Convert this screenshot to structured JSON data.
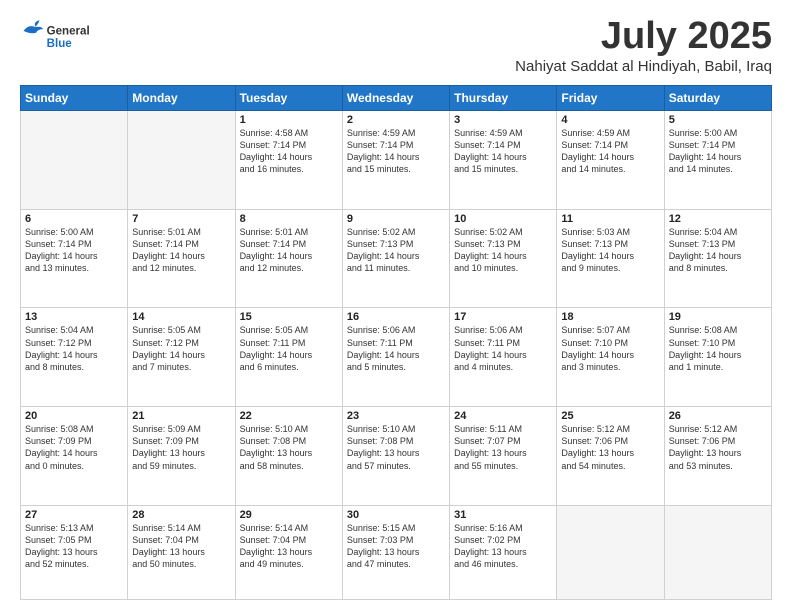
{
  "header": {
    "logo_general": "General",
    "logo_blue": "Blue",
    "month": "July 2025",
    "location": "Nahiyat Saddat al Hindiyah, Babil, Iraq"
  },
  "weekdays": [
    "Sunday",
    "Monday",
    "Tuesday",
    "Wednesday",
    "Thursday",
    "Friday",
    "Saturday"
  ],
  "weeks": [
    [
      {
        "day": "",
        "info": ""
      },
      {
        "day": "",
        "info": ""
      },
      {
        "day": "1",
        "info": "Sunrise: 4:58 AM\nSunset: 7:14 PM\nDaylight: 14 hours\nand 16 minutes."
      },
      {
        "day": "2",
        "info": "Sunrise: 4:59 AM\nSunset: 7:14 PM\nDaylight: 14 hours\nand 15 minutes."
      },
      {
        "day": "3",
        "info": "Sunrise: 4:59 AM\nSunset: 7:14 PM\nDaylight: 14 hours\nand 15 minutes."
      },
      {
        "day": "4",
        "info": "Sunrise: 4:59 AM\nSunset: 7:14 PM\nDaylight: 14 hours\nand 14 minutes."
      },
      {
        "day": "5",
        "info": "Sunrise: 5:00 AM\nSunset: 7:14 PM\nDaylight: 14 hours\nand 14 minutes."
      }
    ],
    [
      {
        "day": "6",
        "info": "Sunrise: 5:00 AM\nSunset: 7:14 PM\nDaylight: 14 hours\nand 13 minutes."
      },
      {
        "day": "7",
        "info": "Sunrise: 5:01 AM\nSunset: 7:14 PM\nDaylight: 14 hours\nand 12 minutes."
      },
      {
        "day": "8",
        "info": "Sunrise: 5:01 AM\nSunset: 7:14 PM\nDaylight: 14 hours\nand 12 minutes."
      },
      {
        "day": "9",
        "info": "Sunrise: 5:02 AM\nSunset: 7:13 PM\nDaylight: 14 hours\nand 11 minutes."
      },
      {
        "day": "10",
        "info": "Sunrise: 5:02 AM\nSunset: 7:13 PM\nDaylight: 14 hours\nand 10 minutes."
      },
      {
        "day": "11",
        "info": "Sunrise: 5:03 AM\nSunset: 7:13 PM\nDaylight: 14 hours\nand 9 minutes."
      },
      {
        "day": "12",
        "info": "Sunrise: 5:04 AM\nSunset: 7:13 PM\nDaylight: 14 hours\nand 8 minutes."
      }
    ],
    [
      {
        "day": "13",
        "info": "Sunrise: 5:04 AM\nSunset: 7:12 PM\nDaylight: 14 hours\nand 8 minutes."
      },
      {
        "day": "14",
        "info": "Sunrise: 5:05 AM\nSunset: 7:12 PM\nDaylight: 14 hours\nand 7 minutes."
      },
      {
        "day": "15",
        "info": "Sunrise: 5:05 AM\nSunset: 7:11 PM\nDaylight: 14 hours\nand 6 minutes."
      },
      {
        "day": "16",
        "info": "Sunrise: 5:06 AM\nSunset: 7:11 PM\nDaylight: 14 hours\nand 5 minutes."
      },
      {
        "day": "17",
        "info": "Sunrise: 5:06 AM\nSunset: 7:11 PM\nDaylight: 14 hours\nand 4 minutes."
      },
      {
        "day": "18",
        "info": "Sunrise: 5:07 AM\nSunset: 7:10 PM\nDaylight: 14 hours\nand 3 minutes."
      },
      {
        "day": "19",
        "info": "Sunrise: 5:08 AM\nSunset: 7:10 PM\nDaylight: 14 hours\nand 1 minute."
      }
    ],
    [
      {
        "day": "20",
        "info": "Sunrise: 5:08 AM\nSunset: 7:09 PM\nDaylight: 14 hours\nand 0 minutes."
      },
      {
        "day": "21",
        "info": "Sunrise: 5:09 AM\nSunset: 7:09 PM\nDaylight: 13 hours\nand 59 minutes."
      },
      {
        "day": "22",
        "info": "Sunrise: 5:10 AM\nSunset: 7:08 PM\nDaylight: 13 hours\nand 58 minutes."
      },
      {
        "day": "23",
        "info": "Sunrise: 5:10 AM\nSunset: 7:08 PM\nDaylight: 13 hours\nand 57 minutes."
      },
      {
        "day": "24",
        "info": "Sunrise: 5:11 AM\nSunset: 7:07 PM\nDaylight: 13 hours\nand 55 minutes."
      },
      {
        "day": "25",
        "info": "Sunrise: 5:12 AM\nSunset: 7:06 PM\nDaylight: 13 hours\nand 54 minutes."
      },
      {
        "day": "26",
        "info": "Sunrise: 5:12 AM\nSunset: 7:06 PM\nDaylight: 13 hours\nand 53 minutes."
      }
    ],
    [
      {
        "day": "27",
        "info": "Sunrise: 5:13 AM\nSunset: 7:05 PM\nDaylight: 13 hours\nand 52 minutes."
      },
      {
        "day": "28",
        "info": "Sunrise: 5:14 AM\nSunset: 7:04 PM\nDaylight: 13 hours\nand 50 minutes."
      },
      {
        "day": "29",
        "info": "Sunrise: 5:14 AM\nSunset: 7:04 PM\nDaylight: 13 hours\nand 49 minutes."
      },
      {
        "day": "30",
        "info": "Sunrise: 5:15 AM\nSunset: 7:03 PM\nDaylight: 13 hours\nand 47 minutes."
      },
      {
        "day": "31",
        "info": "Sunrise: 5:16 AM\nSunset: 7:02 PM\nDaylight: 13 hours\nand 46 minutes."
      },
      {
        "day": "",
        "info": ""
      },
      {
        "day": "",
        "info": ""
      }
    ]
  ]
}
